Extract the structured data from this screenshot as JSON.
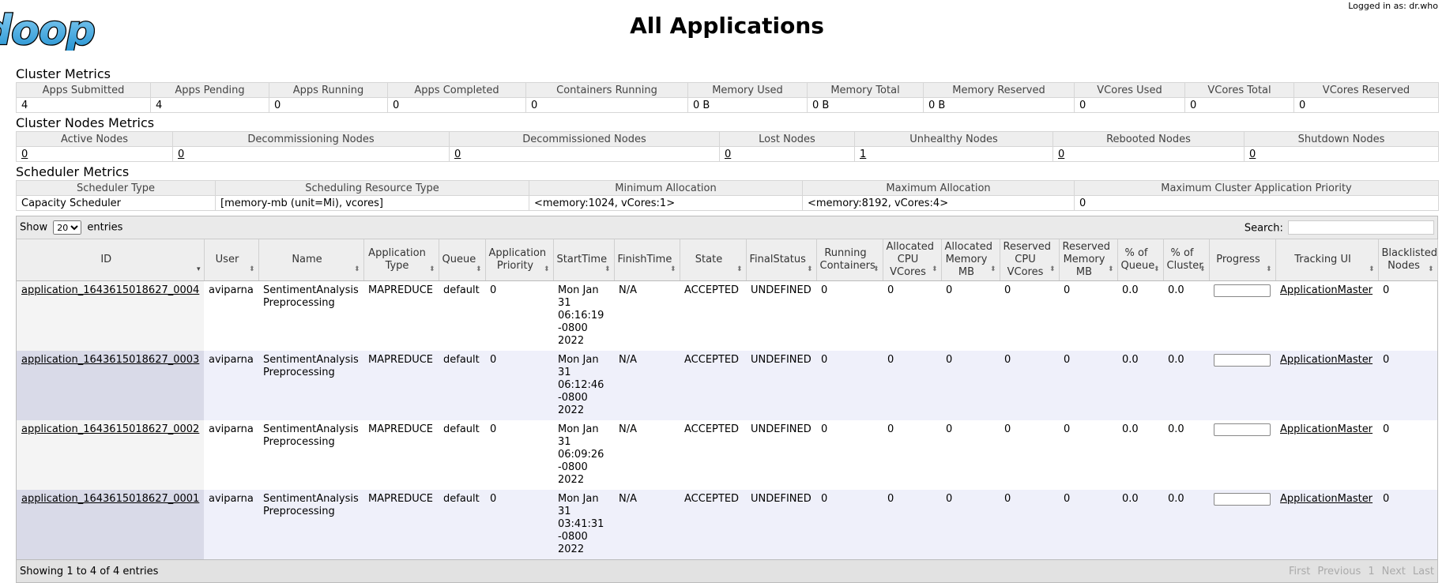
{
  "header": {
    "logo_text": "doop",
    "page_title": "All Applications",
    "logged_in": "Logged in as: dr.who"
  },
  "cluster_metrics": {
    "title": "Cluster Metrics",
    "headers": [
      "Apps Submitted",
      "Apps Pending",
      "Apps Running",
      "Apps Completed",
      "Containers Running",
      "Memory Used",
      "Memory Total",
      "Memory Reserved",
      "VCores Used",
      "VCores Total",
      "VCores Reserved"
    ],
    "values": [
      "4",
      "4",
      "0",
      "0",
      "0",
      "0 B",
      "0 B",
      "0 B",
      "0",
      "0",
      "0"
    ]
  },
  "cluster_nodes_metrics": {
    "title": "Cluster Nodes Metrics",
    "headers": [
      "Active Nodes",
      "Decommissioning Nodes",
      "Decommissioned Nodes",
      "Lost Nodes",
      "Unhealthy Nodes",
      "Rebooted Nodes",
      "Shutdown Nodes"
    ],
    "values": [
      "0",
      "0",
      "0",
      "0",
      "1",
      "0",
      "0"
    ]
  },
  "scheduler_metrics": {
    "title": "Scheduler Metrics",
    "headers": [
      "Scheduler Type",
      "Scheduling Resource Type",
      "Minimum Allocation",
      "Maximum Allocation",
      "Maximum Cluster Application Priority"
    ],
    "values": [
      "Capacity Scheduler",
      "[memory-mb (unit=Mi), vcores]",
      "<memory:1024, vCores:1>",
      "<memory:8192, vCores:4>",
      "0"
    ]
  },
  "apps_table": {
    "show_label": "Show",
    "entries_label": "entries",
    "page_size": "20",
    "search_label": "Search:",
    "search_value": "",
    "headers": [
      "ID",
      "User",
      "Name",
      "Application Type",
      "Queue",
      "Application Priority",
      "StartTime",
      "FinishTime",
      "State",
      "FinalStatus",
      "Running Containers",
      "Allocated CPU VCores",
      "Allocated Memory MB",
      "Reserved CPU VCores",
      "Reserved Memory MB",
      "% of Queue",
      "% of Cluster",
      "Progress",
      "Tracking UI",
      "Blacklisted Nodes"
    ],
    "rows": [
      {
        "id": "application_1643615018627_0004",
        "user": "aviparna",
        "name": "SentimentAnalysis Preprocessing",
        "type": "MAPREDUCE",
        "queue": "default",
        "priority": "0",
        "start": "Mon Jan 31 06:16:19 -0800 2022",
        "finish": "N/A",
        "state": "ACCEPTED",
        "final_status": "UNDEFINED",
        "running": "0",
        "alloc_cpu": "0",
        "alloc_mem": "0",
        "res_cpu": "0",
        "res_mem": "0",
        "pct_queue": "0.0",
        "pct_cluster": "0.0",
        "progress": 0,
        "tracking": "ApplicationMaster",
        "blacklisted": "0"
      },
      {
        "id": "application_1643615018627_0003",
        "user": "aviparna",
        "name": "SentimentAnalysis Preprocessing",
        "type": "MAPREDUCE",
        "queue": "default",
        "priority": "0",
        "start": "Mon Jan 31 06:12:46 -0800 2022",
        "finish": "N/A",
        "state": "ACCEPTED",
        "final_status": "UNDEFINED",
        "running": "0",
        "alloc_cpu": "0",
        "alloc_mem": "0",
        "res_cpu": "0",
        "res_mem": "0",
        "pct_queue": "0.0",
        "pct_cluster": "0.0",
        "progress": 0,
        "tracking": "ApplicationMaster",
        "blacklisted": "0"
      },
      {
        "id": "application_1643615018627_0002",
        "user": "aviparna",
        "name": "SentimentAnalysis Preprocessing",
        "type": "MAPREDUCE",
        "queue": "default",
        "priority": "0",
        "start": "Mon Jan 31 06:09:26 -0800 2022",
        "finish": "N/A",
        "state": "ACCEPTED",
        "final_status": "UNDEFINED",
        "running": "0",
        "alloc_cpu": "0",
        "alloc_mem": "0",
        "res_cpu": "0",
        "res_mem": "0",
        "pct_queue": "0.0",
        "pct_cluster": "0.0",
        "progress": 0,
        "tracking": "ApplicationMaster",
        "blacklisted": "0"
      },
      {
        "id": "application_1643615018627_0001",
        "user": "aviparna",
        "name": "SentimentAnalysis Preprocessing",
        "type": "MAPREDUCE",
        "queue": "default",
        "priority": "0",
        "start": "Mon Jan 31 03:41:31 -0800 2022",
        "finish": "N/A",
        "state": "ACCEPTED",
        "final_status": "UNDEFINED",
        "running": "0",
        "alloc_cpu": "0",
        "alloc_mem": "0",
        "res_cpu": "0",
        "res_mem": "0",
        "pct_queue": "0.0",
        "pct_cluster": "0.0",
        "progress": 0,
        "tracking": "ApplicationMaster",
        "blacklisted": "0"
      }
    ],
    "info": "Showing 1 to 4 of 4 entries",
    "pager": [
      "First",
      "Previous",
      "1",
      "Next",
      "Last"
    ]
  }
}
